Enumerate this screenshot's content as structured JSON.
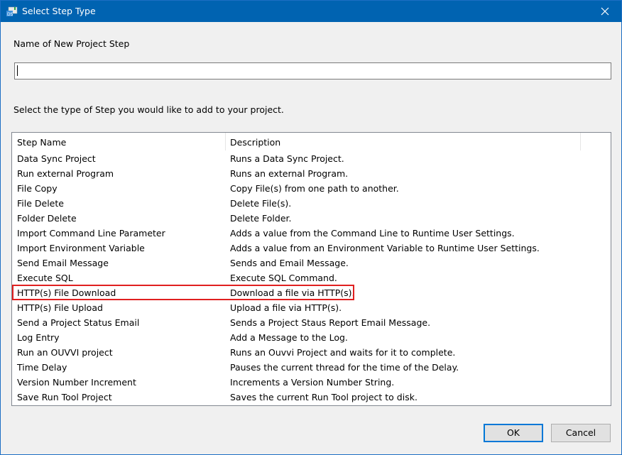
{
  "window": {
    "title": "Select Step Type",
    "app_icon": "app-icon",
    "close_icon": "close-icon"
  },
  "form": {
    "name_label": "Name of New Project Step",
    "name_value": "",
    "select_prompt": "Select the type of Step you would like to add to your project."
  },
  "list": {
    "columns": [
      "Step Name",
      "Description"
    ],
    "highlighted_index": 9,
    "rows": [
      {
        "name": "Data Sync Project",
        "description": "Runs a Data Sync Project."
      },
      {
        "name": "Run external Program",
        "description": "Runs an external Program."
      },
      {
        "name": "File Copy",
        "description": "Copy File(s) from one path to another."
      },
      {
        "name": "File Delete",
        "description": "Delete File(s)."
      },
      {
        "name": "Folder Delete",
        "description": "Delete Folder."
      },
      {
        "name": "Import Command Line Parameter",
        "description": "Adds a value from the Command Line to Runtime User Settings."
      },
      {
        "name": "Import Environment Variable",
        "description": "Adds a value from an Environment Variable to Runtime User Settings."
      },
      {
        "name": "Send Email Message",
        "description": "Sends and Email Message."
      },
      {
        "name": "Execute SQL",
        "description": "Execute SQL Command."
      },
      {
        "name": "HTTP(s) File Download",
        "description": "Download a file via HTTP(s)."
      },
      {
        "name": "HTTP(s) File Upload",
        "description": "Upload a file via HTTP(s)."
      },
      {
        "name": "Send a Project Status Email",
        "description": "Sends a Project Staus Report Email Message."
      },
      {
        "name": "Log Entry",
        "description": "Add a Message to the Log."
      },
      {
        "name": "Run an OUVVI project",
        "description": "Runs an Ouvvi Project and waits for it to complete."
      },
      {
        "name": "Time Delay",
        "description": "Pauses the current thread for the time of the Delay."
      },
      {
        "name": "Version Number Increment",
        "description": "Increments a Version Number String."
      },
      {
        "name": "Save Run Tool Project",
        "description": "Saves the current Run Tool project to disk."
      }
    ]
  },
  "buttons": {
    "ok": "OK",
    "cancel": "Cancel"
  },
  "colors": {
    "titlebar": "#0063b1",
    "highlight_border": "#e02020",
    "default_button_border": "#0078d7"
  }
}
